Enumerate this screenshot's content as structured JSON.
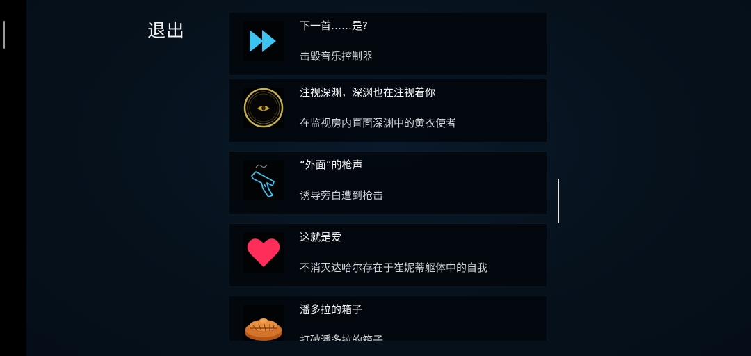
{
  "header": {
    "exit_label": "退出"
  },
  "achievements": [
    {
      "title": "下一首……是?",
      "description": "击毁音乐控制器",
      "icon": "fast-forward-icon"
    },
    {
      "title": "注视深渊，深渊也在注视着你",
      "description": "在监视房内直面深渊中的黄衣使者",
      "icon": "eye-icon"
    },
    {
      "title": "“外面”的枪声",
      "description": "诱导旁白遭到枪击",
      "icon": "pistol-icon"
    },
    {
      "title": "这就是爱",
      "description": "不消灭达哈尔存在于崔妮蒂躯体中的自我",
      "icon": "heart-icon"
    },
    {
      "title": "潘多拉的箱子",
      "description": "打破潘多拉的箱子",
      "icon": "pandora-box-icon"
    }
  ],
  "colors": {
    "cyan_icon": "#3cc3f0",
    "gold_ring": "#c8b04a",
    "heart": "#ff2d5a",
    "box": "#d4742a",
    "background": "#06111c"
  }
}
